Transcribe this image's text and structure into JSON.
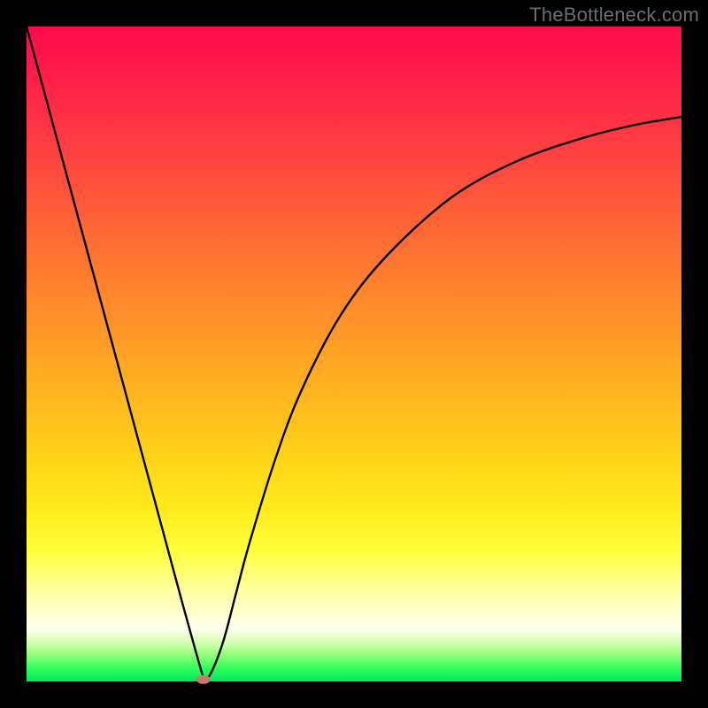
{
  "watermark": "TheBottleneck.com",
  "chart_data": {
    "type": "line",
    "title": "",
    "xlabel": "",
    "ylabel": "",
    "xlim": [
      0,
      1
    ],
    "ylim": [
      0,
      1
    ],
    "series": [
      {
        "name": "curve",
        "x": [
          0.0,
          0.05,
          0.1,
          0.15,
          0.2,
          0.24,
          0.26,
          0.27,
          0.28,
          0.3,
          0.32,
          0.34,
          0.38,
          0.42,
          0.48,
          0.55,
          0.65,
          0.75,
          0.85,
          0.93,
          1.0
        ],
        "y": [
          1.0,
          0.815,
          0.63,
          0.445,
          0.26,
          0.112,
          0.04,
          0.005,
          0.01,
          0.06,
          0.135,
          0.21,
          0.34,
          0.445,
          0.56,
          0.65,
          0.74,
          0.795,
          0.83,
          0.85,
          0.862
        ]
      }
    ],
    "annotations": {
      "min_marker": {
        "x": 0.27,
        "y": 0.003
      }
    },
    "description": "Single black V-shaped curve on a smooth red-to-green vertical heat gradient. Curve is piecewise: steep near-linear descent from top-left down to a sharp minimum near x≈0.27 at the bottom, then a concave rise flattening toward the right edge at roughly 86% height. A small muted-salmon ellipse marks the minimum.",
    "background_gradient": {
      "stops": [
        {
          "pos": 0.0,
          "color": "#ff0a4c"
        },
        {
          "pos": 0.45,
          "color": "#ff9228"
        },
        {
          "pos": 0.8,
          "color": "#ffff3a"
        },
        {
          "pos": 0.92,
          "color": "#fffff0"
        },
        {
          "pos": 1.0,
          "color": "#00e85e"
        }
      ]
    }
  }
}
